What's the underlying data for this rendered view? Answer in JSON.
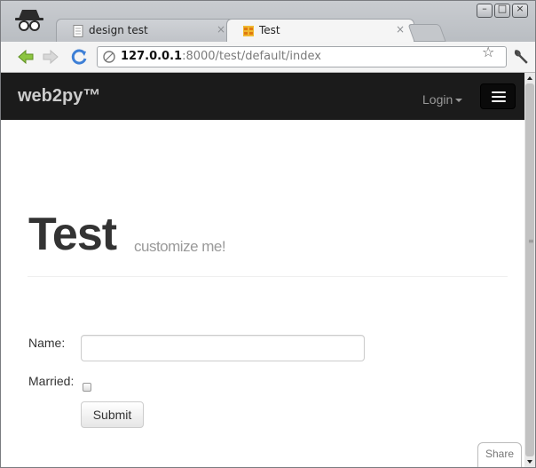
{
  "browser": {
    "tabs": [
      {
        "label": "design test",
        "close": "×"
      },
      {
        "label": "Test",
        "close": "×"
      }
    ],
    "url_host": "127.0.0.1",
    "url_rest": ":8000/test/default/index"
  },
  "page": {
    "brand": "web2py™",
    "login_label": "Login",
    "title": "Test",
    "subtitle": "customize me!",
    "form": {
      "name_label": "Name:",
      "married_label": "Married:",
      "name_value": "",
      "married_checked": false,
      "submit_label": "Submit"
    },
    "share_label": "Share"
  },
  "colors": {
    "navbar": "#1b1b1b",
    "title_text": "#333333",
    "subtitle_text": "#999999"
  }
}
